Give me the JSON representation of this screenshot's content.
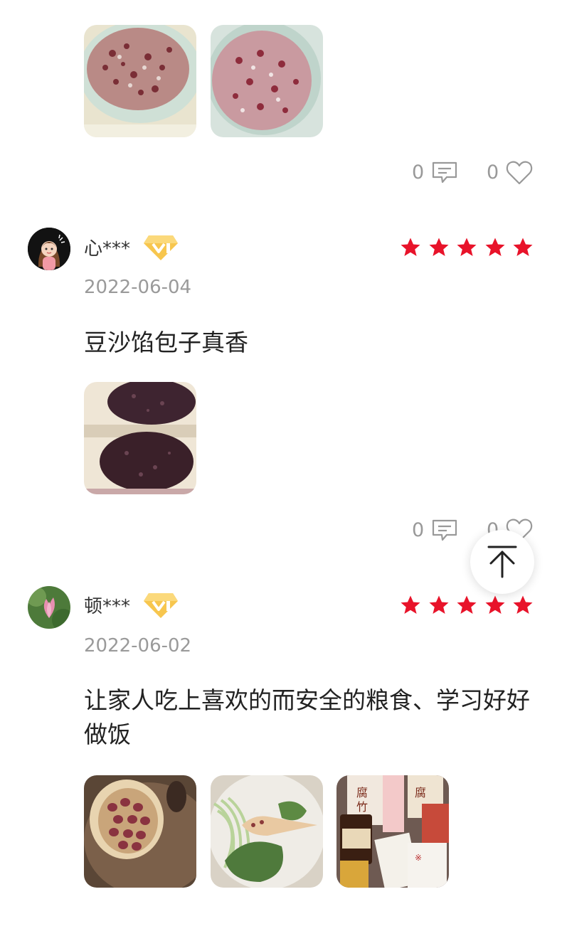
{
  "reviews": [
    {
      "photos": [
        "porridge-photo-1",
        "porridge-photo-2"
      ],
      "comment_count": "0",
      "like_count": "0"
    },
    {
      "user": "心***",
      "date": "2022-06-04",
      "rating": 5,
      "text": "豆沙馅包子真香",
      "photos": [
        "bean-bun-photo"
      ],
      "comment_count": "0",
      "like_count": "0"
    },
    {
      "user": "顿***",
      "date": "2022-06-02",
      "rating": 5,
      "text": "让家人吃上喜欢的而安全的粮食、学习好好做饭",
      "photos": [
        "red-beans-spoon-photo",
        "vegetables-plate-photo",
        "grocery-products-photo"
      ]
    }
  ],
  "colors": {
    "star": "#e8132a",
    "badge": "#f3b53a",
    "secondary_text": "#999999"
  },
  "icons": [
    "comment-icon",
    "heart-icon",
    "star-icon",
    "vip-badge-icon",
    "back-to-top-icon"
  ]
}
